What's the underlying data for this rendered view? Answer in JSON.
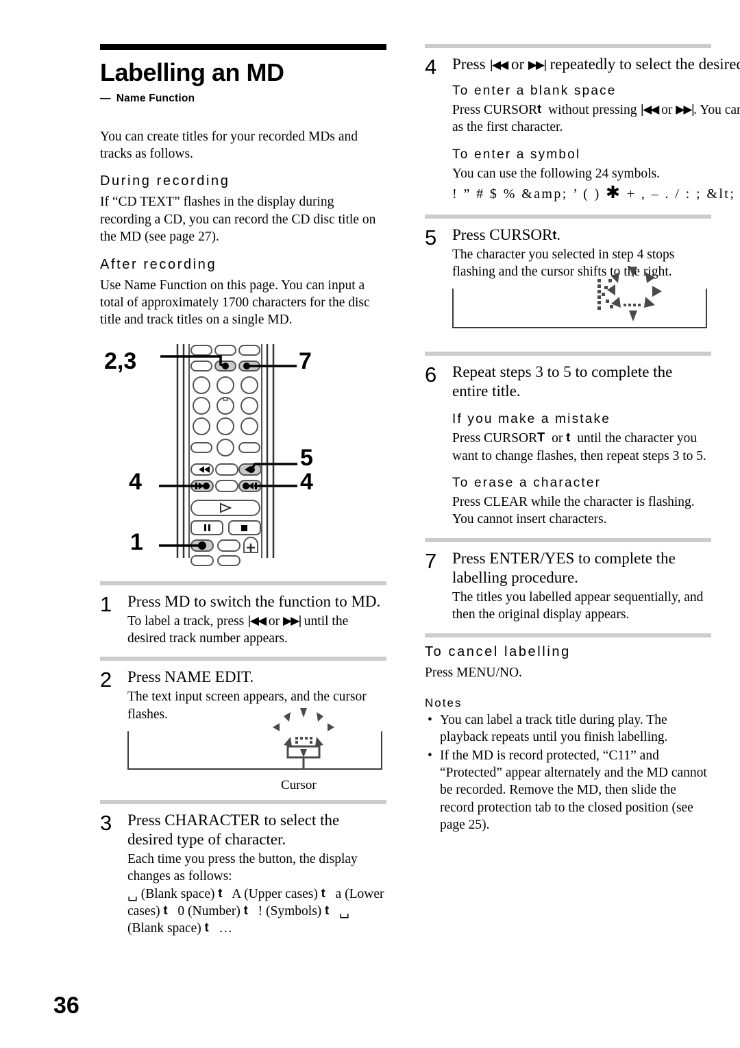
{
  "page": {
    "number": "36"
  },
  "left": {
    "title": "Labelling an MD",
    "subtitle_dash": "—",
    "subtitle": "Name Function",
    "intro": "You can create titles for your recorded MDs and tracks as follows.",
    "sections": [
      {
        "heading": "During recording",
        "body": "If “CD TEXT” flashes in the display during recording a CD, you can record the CD disc title on the MD (see page 27)."
      },
      {
        "heading": "After recording",
        "body": "Use Name Function on this page. You can input a total of approximately 1700 characters for the disc title and track titles on a single MD."
      }
    ],
    "figure": {
      "callouts": [
        "2,3",
        "7",
        "5",
        "4",
        "4",
        "1"
      ],
      "play_glyph": "▷",
      "pause_glyph": "❚❚",
      "stop_glyph": "■",
      "plus_glyph": "+"
    },
    "steps": [
      {
        "num": "1",
        "lead": "Press MD to switch the function to MD.",
        "detail_a": "To label a track, press",
        "detail_b": "or",
        "detail_c": "until the desired track number appears."
      },
      {
        "num": "2",
        "lead": "Press NAME EDIT.",
        "detail": "The text input screen appears, and the cursor flashes.",
        "cursor_label": "Cursor"
      },
      {
        "num": "3",
        "lead": "Press CHARACTER to select the desired type of character.",
        "detail": "Each time you press the button, the display changes as follows:",
        "sequence": [
          "␣ (Blank space)",
          "A (Upper cases)",
          "a (Lower cases)",
          "0 (Number)",
          "! (Symbols)",
          "␣ (Blank space)",
          "…"
        ]
      }
    ]
  },
  "right": {
    "steps": [
      {
        "num": "4",
        "lead_a": "Press",
        "lead_b": "or",
        "lead_c": "repeatedly to select the desired character."
      },
      {
        "num": "5",
        "lead": "Press  CURSOR",
        "detail": "The character you selected in step 4 stops flashing and the cursor shifts to the right.",
        "display_char": "K"
      },
      {
        "num": "6",
        "lead": "Repeat steps 3 to 5 to complete the entire title."
      },
      {
        "num": "7",
        "lead": "Press ENTER/YES to complete the labelling procedure.",
        "detail": "The titles you labelled appear sequentially, and then the original display appears."
      }
    ],
    "blank_space": {
      "heading": "To enter a blank space",
      "body_a": "Press CURSOR",
      "body_b": "without pressing",
      "body_c": "or",
      "body_d": ". You cannot enter a space as the first character."
    },
    "symbol": {
      "heading": "To enter a symbol",
      "body": "You can use the following 24 symbols.",
      "list_a": "! ” # $ % &amp; ’ ( )",
      "list_star": "✱",
      "list_b": "+ , – . / :  ; &lt; = &gt; ? @ _ `"
    },
    "mistake": {
      "heading": "If you make a mistake",
      "body_a": "Press CURSOR",
      "body_b": "or",
      "body_c": "until the character you want to change flashes, then repeat steps 3 to 5."
    },
    "erase": {
      "heading": "To erase a character",
      "body": "Press CLEAR while the character is flashing. You cannot insert characters."
    },
    "cancel": {
      "heading": "To cancel labelling",
      "body": "Press MENU/NO."
    },
    "notes": {
      "heading": "Notes",
      "items": [
        "You can label a track title during play. The playback repeats until you finish labelling.",
        "If the MD is record protected, “C11” and “Protected” appear alternately and the MD cannot be recorded. Remove the MD, then slide the record protection tab to the closed position (see page 25)."
      ]
    }
  },
  "glyphs": {
    "prev": "|◀◀",
    "next": "▶▶|",
    "arrow_right": "t",
    "arrow_left": "T"
  }
}
